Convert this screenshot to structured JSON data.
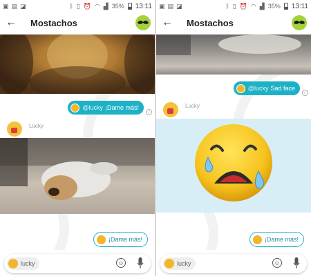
{
  "status_bar": {
    "time": "13:11",
    "battery": "35%"
  },
  "app_bar": {
    "title": "Mostachos"
  },
  "left": {
    "sent_message": {
      "mention": "@lucky",
      "text": "¡Dame más!"
    },
    "sender": "Lucky",
    "suggestion": "¡Dame más!"
  },
  "right": {
    "sent_message": {
      "mention": "@lucky",
      "text": "Sad face"
    },
    "sender": "Lucky",
    "suggestion": "¡Dame más!"
  },
  "input": {
    "lucky_chip": "lucky"
  },
  "colors": {
    "accent": "#1eb1c6",
    "mustache_avatar": "#a4d23a",
    "lucky_avatar": "#f1b62a"
  },
  "icons": [
    "back-arrow-icon",
    "mustache-icon",
    "emoji-icon",
    "mic-icon",
    "read-check-icon"
  ]
}
